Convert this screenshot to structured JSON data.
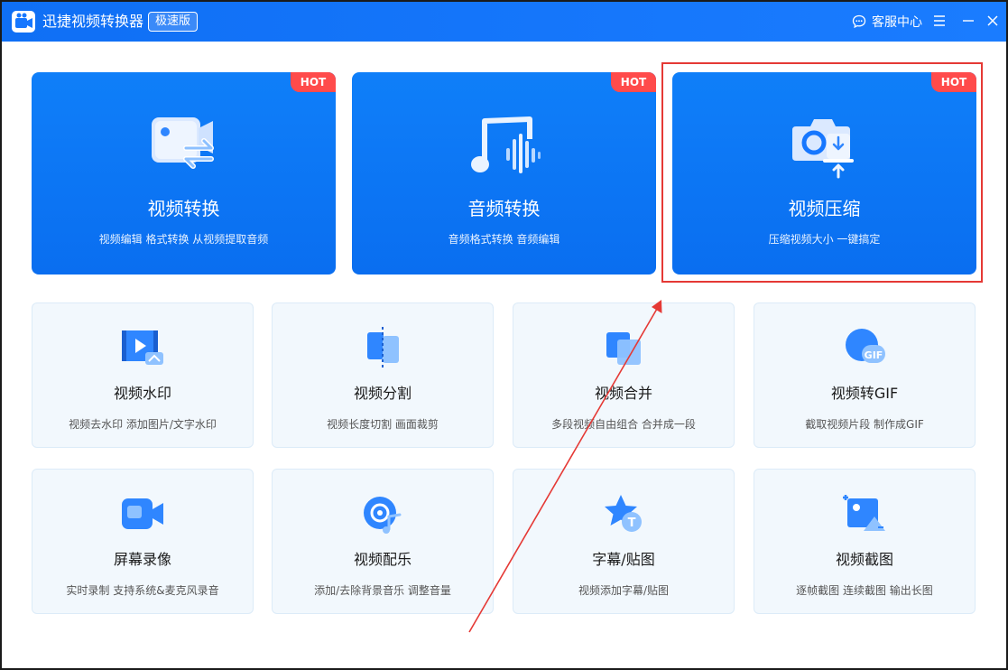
{
  "app": {
    "title": "迅捷视频转换器",
    "edition": "极速版",
    "support_label": "客服中心"
  },
  "colors": {
    "primary": "#1677ff",
    "hot_badge": "#ff4b4b",
    "card_bg": "#f2f8fd",
    "highlight": "#e53935"
  },
  "featured": [
    {
      "title": "视频转换",
      "subtitle": "视频编辑 格式转换 从视频提取音频",
      "badge": "HOT",
      "icon": "video-convert-icon"
    },
    {
      "title": "音频转换",
      "subtitle": "音频格式转换 音频编辑",
      "badge": "HOT",
      "icon": "audio-convert-icon"
    },
    {
      "title": "视频压缩",
      "subtitle": "压缩视频大小 一键搞定",
      "badge": "HOT",
      "icon": "video-compress-icon"
    }
  ],
  "tools": [
    {
      "title": "视频水印",
      "subtitle": "视频去水印 添加图片/文字水印",
      "icon": "watermark-icon"
    },
    {
      "title": "视频分割",
      "subtitle": "视频长度切割 画面裁剪",
      "icon": "split-icon"
    },
    {
      "title": "视频合并",
      "subtitle": "多段视频自由组合 合并成一段",
      "icon": "merge-icon"
    },
    {
      "title": "视频转GIF",
      "subtitle": "截取视频片段 制作成GIF",
      "icon": "gif-icon",
      "icon_text": "GIF"
    },
    {
      "title": "屏幕录像",
      "subtitle": "实时录制 支持系统&麦克风录音",
      "icon": "screen-record-icon"
    },
    {
      "title": "视频配乐",
      "subtitle": "添加/去除背景音乐 调整音量",
      "icon": "music-icon"
    },
    {
      "title": "字幕/贴图",
      "subtitle": "视频添加字幕/贴图",
      "icon": "subtitle-sticker-icon",
      "icon_text": "T"
    },
    {
      "title": "视频截图",
      "subtitle": "逐帧截图 连续截图 输出长图",
      "icon": "screenshot-icon"
    }
  ]
}
